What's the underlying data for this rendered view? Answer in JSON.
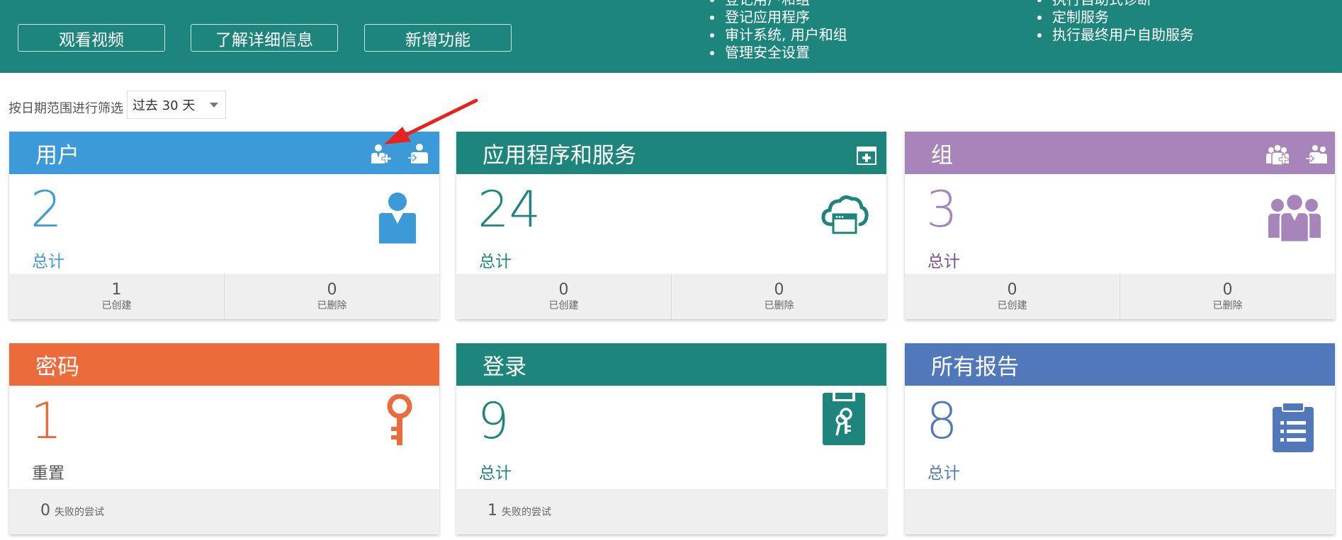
{
  "colors": {
    "banner": "#1e857c",
    "users": "#3d9ad9",
    "apps": "#1e857c",
    "groups": "#a784b9",
    "passwords": "#ec6b3a",
    "logins": "#1e857c",
    "reports": "#5078bb",
    "arrow": "#e8231d"
  },
  "banner": {
    "buttons": [
      {
        "label": "观看视频"
      },
      {
        "label": "了解详细信息"
      },
      {
        "label": "新增功能"
      }
    ],
    "list_left": [
      "登记用户和组",
      "登记应用程序",
      "审计系统, 用户和组",
      "管理安全设置"
    ],
    "list_right": [
      "执行自助式诊断",
      "定制服务",
      "执行最终用户自助服务"
    ]
  },
  "filter": {
    "label": "按日期范围进行筛选",
    "selected": "过去 30 天"
  },
  "cards": {
    "users": {
      "title": "用户",
      "count": "2",
      "total_label": "总计",
      "stats": [
        {
          "value": "1",
          "label": "已创建"
        },
        {
          "value": "0",
          "label": "已删除"
        }
      ],
      "header_icons": [
        "add-user-icon",
        "import-user-icon"
      ],
      "icon": "user-icon"
    },
    "apps": {
      "title": "应用程序和服务",
      "count": "24",
      "total_label": "总计",
      "stats": [
        {
          "value": "0",
          "label": "已创建"
        },
        {
          "value": "0",
          "label": "已删除"
        }
      ],
      "header_icons": [
        "add-app-icon"
      ],
      "icon": "cloud-app-icon"
    },
    "groups": {
      "title": "组",
      "count": "3",
      "total_label": "总计",
      "stats": [
        {
          "value": "0",
          "label": "已创建"
        },
        {
          "value": "0",
          "label": "已删除"
        }
      ],
      "header_icons": [
        "add-group-icon",
        "import-group-icon"
      ],
      "icon": "group-icon"
    },
    "passwords": {
      "title": "密码",
      "count": "1",
      "total_label": "重置",
      "fail": {
        "value": "0",
        "label": "失败的尝试"
      },
      "icon": "key-icon"
    },
    "logins": {
      "title": "登录",
      "count": "9",
      "total_label": "总计",
      "fail": {
        "value": "1",
        "label": "失败的尝试"
      },
      "icon": "login-keys-icon"
    },
    "reports": {
      "title": "所有报告",
      "count": "8",
      "total_label": "总计",
      "icon": "report-clipboard-icon"
    }
  }
}
